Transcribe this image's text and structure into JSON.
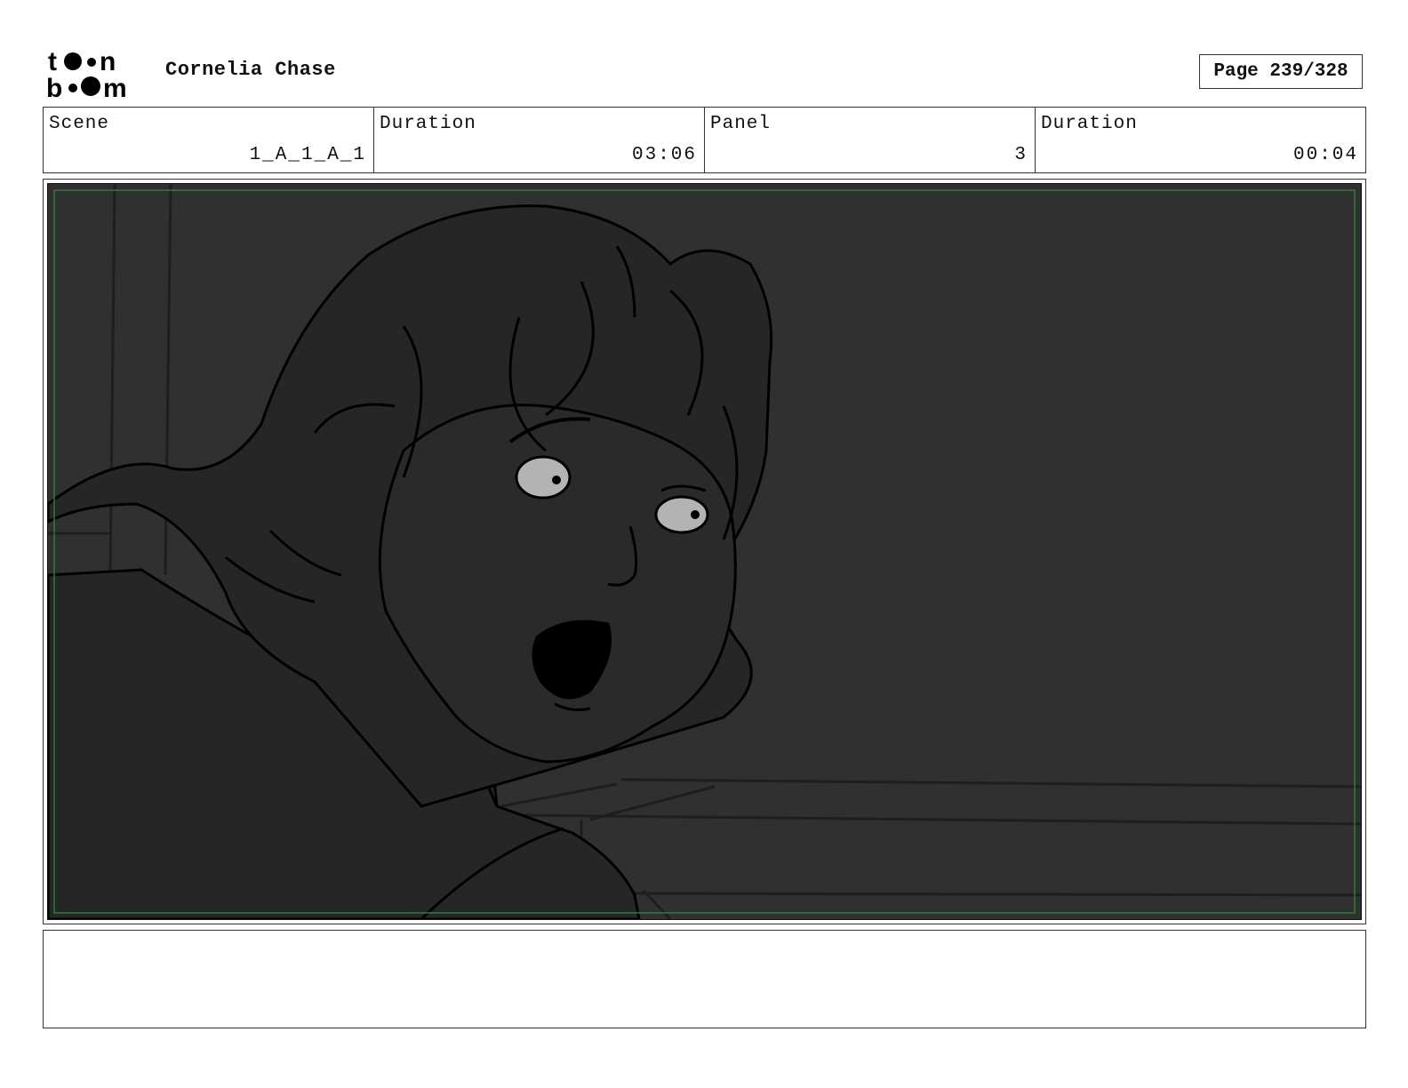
{
  "header": {
    "logo_text_top": "toon",
    "logo_text_bottom": "boom",
    "project_title": "Cornelia Chase",
    "page_label": "Page 239/328"
  },
  "info": [
    {
      "label": "Scene",
      "value": "1_A_1_A_1"
    },
    {
      "label": "Duration",
      "value": "03:06"
    },
    {
      "label": "Panel",
      "value": "3"
    },
    {
      "label": "Duration",
      "value": "00:04"
    }
  ],
  "panel": {
    "background_color": "#303030",
    "foreground_color": "#262626",
    "line_color": "#000000",
    "safe_frame_color": "#2e7d32",
    "eye_color": "#b3b3b3"
  },
  "notes": ""
}
